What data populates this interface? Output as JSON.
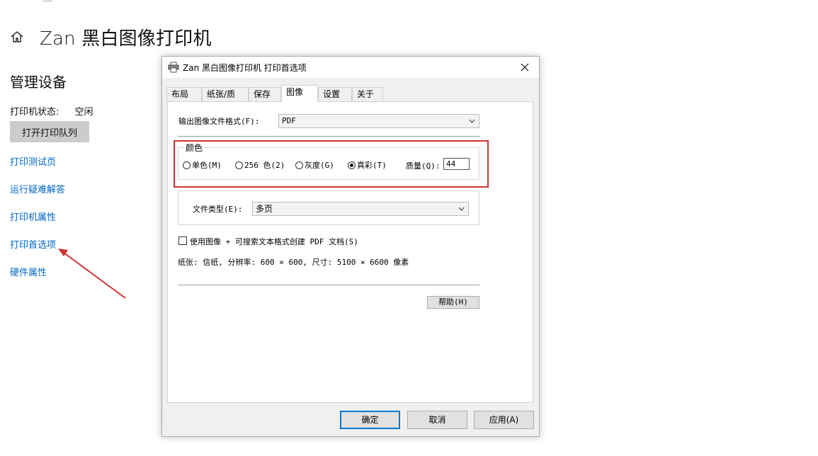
{
  "page": {
    "title": "Zan 黑白图像打印机",
    "section_title": "管理设备",
    "status_label": "打印机状态:",
    "status_value": "空闲",
    "open_queue_button": "打开打印队列",
    "links": [
      "打印测试页",
      "运行疑难解答",
      "打印机属性",
      "打印首选项",
      "硬件属性"
    ]
  },
  "dialog": {
    "title": "Zan 黑白图像打印机 打印首选项",
    "tabs": [
      {
        "label": "布局",
        "active": false
      },
      {
        "label": "纸张/质量",
        "active": false
      },
      {
        "label": "保存",
        "active": false
      },
      {
        "label": "图像",
        "active": true
      },
      {
        "label": "设置",
        "active": false
      },
      {
        "label": "关于",
        "active": false
      }
    ],
    "format_label": "输出图像文件格式(F):",
    "format_value": "PDF",
    "color_group_label": "颜色",
    "color_options": [
      {
        "label": "单色(M)",
        "selected": false
      },
      {
        "label": "256 色(2)",
        "selected": false
      },
      {
        "label": "灰度(G)",
        "selected": false
      },
      {
        "label": "真彩(T)",
        "selected": true
      }
    ],
    "quality_label": "质量(Q):",
    "quality_value": "44",
    "filetype_label": "文件类型(E):",
    "filetype_value": "多页",
    "searchable_pdf_label": "使用图像 + 可搜索文本格式创建 PDF 文档(S)",
    "searchable_pdf_checked": false,
    "paper_info": "纸张: 信纸, 分辨率: 600 × 600, 尺寸: 5100 × 6600 像素",
    "help_button": "帮助(H)",
    "ok_button": "确定",
    "cancel_button": "取消",
    "apply_button": "应用(A)"
  },
  "colors": {
    "link": "#0067c0",
    "highlight": "#d03232",
    "default_button_border": "#0078d7"
  },
  "icons": {
    "home": "home-icon",
    "printer": "printer-icon",
    "close": "close-icon",
    "chevron": "chevron-down-icon",
    "annotation_arrow": "arrow-icon"
  }
}
